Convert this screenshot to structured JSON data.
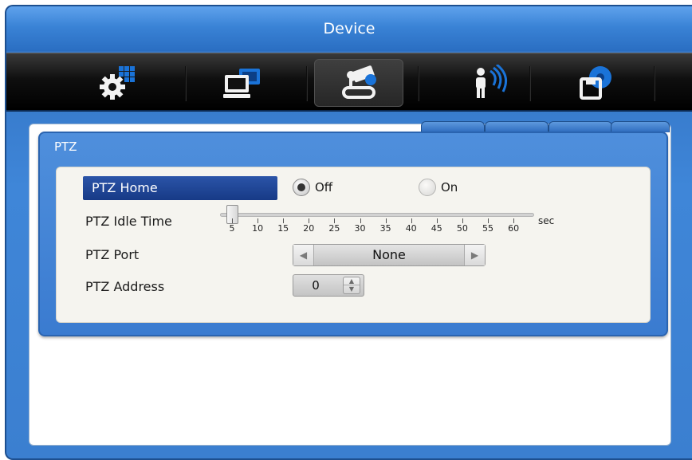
{
  "window": {
    "title": "Device"
  },
  "toolbar": {
    "items": [
      {
        "name": "system-settings",
        "icon": "gear-grid-icon",
        "active": false
      },
      {
        "name": "device-computer",
        "icon": "computer-icon",
        "active": false
      },
      {
        "name": "ptz-control",
        "icon": "camera-joystick-icon",
        "active": true
      },
      {
        "name": "alarm-sensor",
        "icon": "person-signal-icon",
        "active": false
      },
      {
        "name": "storage",
        "icon": "disk-icon",
        "active": false
      }
    ]
  },
  "ptz": {
    "title": "PTZ",
    "home": {
      "label": "PTZ Home",
      "options": [
        "Off",
        "On"
      ],
      "selected": "Off"
    },
    "idle_time": {
      "label": "PTZ Idle Time",
      "ticks": [
        "5",
        "10",
        "15",
        "20",
        "25",
        "30",
        "35",
        "40",
        "45",
        "50",
        "55",
        "60"
      ],
      "value": 5,
      "unit": "sec"
    },
    "port": {
      "label": "PTZ Port",
      "value": "None"
    },
    "address": {
      "label": "PTZ Address",
      "value": "0"
    }
  },
  "colors": {
    "accent": "#3a7bd0",
    "selected_label": "#173a86",
    "toolbar_bg": "#000000"
  }
}
